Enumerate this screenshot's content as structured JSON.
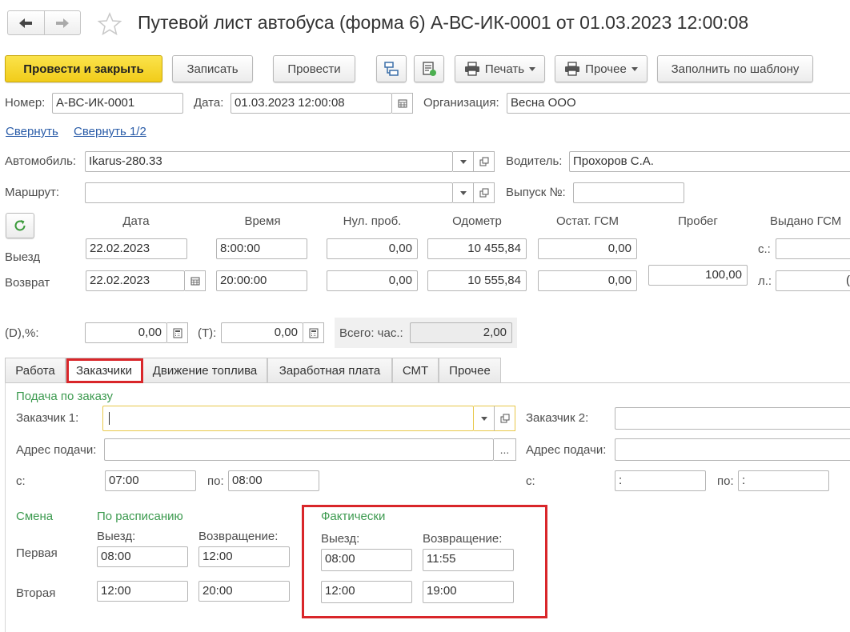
{
  "title": "Путевой лист автобуса (форма 6) А-ВС-ИК-0001 от 01.03.2023 12:00:08",
  "toolbar": {
    "post_close": "Провести и закрыть",
    "save": "Записать",
    "post": "Провести",
    "print": "Печать",
    "other": "Прочее",
    "fill_template": "Заполнить по шаблону"
  },
  "header": {
    "number_label": "Номер:",
    "number": "А-ВС-ИК-0001",
    "date_label": "Дата:",
    "date": "01.03.2023 12:00:08",
    "org_label": "Организация:",
    "org": "Весна ООО",
    "collapse": "Свернуть",
    "collapse_half": "Свернуть 1/2",
    "car_label": "Автомобиль:",
    "car": "Ikarus-280.33",
    "driver_label": "Водитель:",
    "driver": "Прохоров С.А.",
    "route_label": "Маршрут:",
    "route": "",
    "release_label": "Выпуск №:",
    "release": ""
  },
  "grid": {
    "columns": [
      "Дата",
      "Время",
      "Нул. проб.",
      "Одометр",
      "Остат. ГСМ",
      "Пробег",
      "Выдано ГСМ"
    ],
    "exit_label": "Выезд",
    "return_label": "Возврат",
    "exit": {
      "date": "22.02.2023",
      "time": "8:00:00",
      "null_run": "0,00",
      "odometer": "10 455,84",
      "fuel_left": "0,00"
    },
    "return": {
      "date": "22.02.2023",
      "time": "20:00:00",
      "null_run": "0,00",
      "odometer": "10 555,84",
      "fuel_left": "0,00"
    },
    "mileage": "100,00",
    "issued_s_label": "с.:",
    "issued_l_label": "л.:",
    "issued_l_partial": "("
  },
  "totals": {
    "d_label": "(D),%:",
    "d_value": "0,00",
    "t_label": "(T):",
    "t_value": "0,00",
    "hours_label": "Всего: час.:",
    "hours_value": "2,00"
  },
  "tabs": [
    "Работа",
    "Заказчики",
    "Движение топлива",
    "Заработная плата",
    "СМТ",
    "Прочее"
  ],
  "customers": {
    "section_title": "Подача по заказу",
    "customer1_label": "Заказчик 1:",
    "customer1": "",
    "customer2_label": "Заказчик 2:",
    "customer2": "",
    "address_label": "Адрес подачи:",
    "address1": "",
    "address2_label": "Адрес подачи:",
    "address2": "",
    "from_label": "с:",
    "from1": "07:00",
    "to_label": "по:",
    "to1": "08:00",
    "from2_label": "с:",
    "from2": " :",
    "to2_label": "по:",
    "to2": " :",
    "ellipsis": "..."
  },
  "shifts": {
    "shift_label": "Смена",
    "scheduled_label": "По расписанию",
    "actual_label": "Фактически",
    "exit_label": "Выезд:",
    "return_label": "Возвращение:",
    "first_label": "Первая",
    "second_label": "Вторая",
    "first": {
      "sched_exit": "08:00",
      "sched_return": "12:00",
      "actual_exit": "08:00",
      "actual_return": "11:55"
    },
    "second": {
      "sched_exit": "12:00",
      "sched_return": "20:00",
      "actual_exit": "12:00",
      "actual_return": "19:00"
    }
  }
}
